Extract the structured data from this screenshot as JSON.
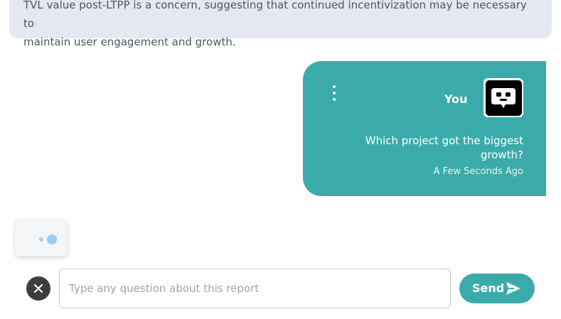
{
  "previous_message": {
    "line1": "TVL value post-LTPP is a concern, suggesting that continued incentivization may be necessary to",
    "line2": "maintain user engagement and growth."
  },
  "user_message": {
    "sender": "You",
    "text": "Which project got the biggest growth?",
    "timestamp": "A Few Seconds Ago",
    "menu_icon": "kebab-menu-icon",
    "avatar_icon": "chat-bubble-icon"
  },
  "typing_indicator": {
    "icon": "typing-dots-icon"
  },
  "composer": {
    "placeholder": "Type any question about this report",
    "value": "",
    "close_icon": "close-icon",
    "send_label": "Send",
    "send_icon": "send-arrow-icon"
  },
  "colors": {
    "accent": "#3aabaa",
    "previous_bubble": "#e4e9f1",
    "close_button": "#3d3d3d"
  }
}
